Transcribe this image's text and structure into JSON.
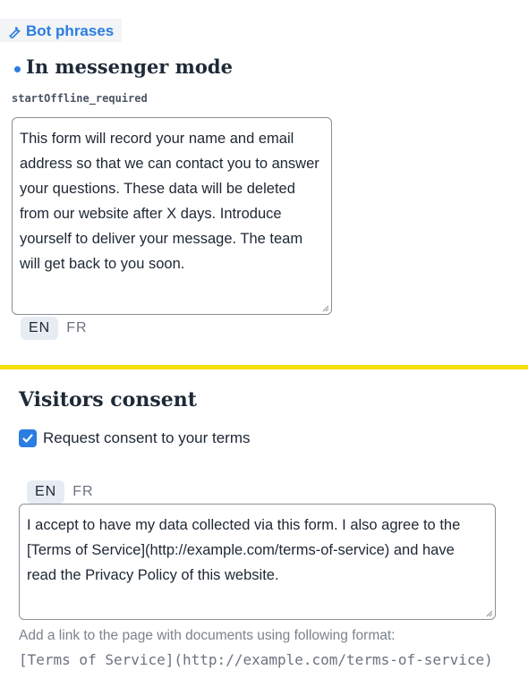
{
  "header": {
    "bot_phrases_label": "Bot phrases",
    "icon": "wrench-icon"
  },
  "messenger_mode": {
    "title": "In messenger mode",
    "key": "startOffline_required",
    "text": "This form will record your name and email address so that we can contact you to answer your questions. These data will be deleted from our website after X days. Introduce yourself to deliver your message. The team will get back to you soon.",
    "languages": [
      "EN",
      "FR"
    ],
    "active_language": "EN"
  },
  "consent": {
    "title": "Visitors consent",
    "checkbox_label": "Request consent to your terms",
    "checked": true,
    "languages": [
      "EN",
      "FR"
    ],
    "active_language": "EN",
    "text": "I accept to have my data collected via this form. I also agree to the [Terms of Service](http://example.com/terms-of-service) and have read the Privacy Policy of this website.",
    "hint": "Add a link to the page with documents using following format:",
    "hint_code": "[Terms of Service](http://example.com/terms-of-service)"
  },
  "colors": {
    "accent": "#2b7de1",
    "divider": "#f7df0c"
  }
}
